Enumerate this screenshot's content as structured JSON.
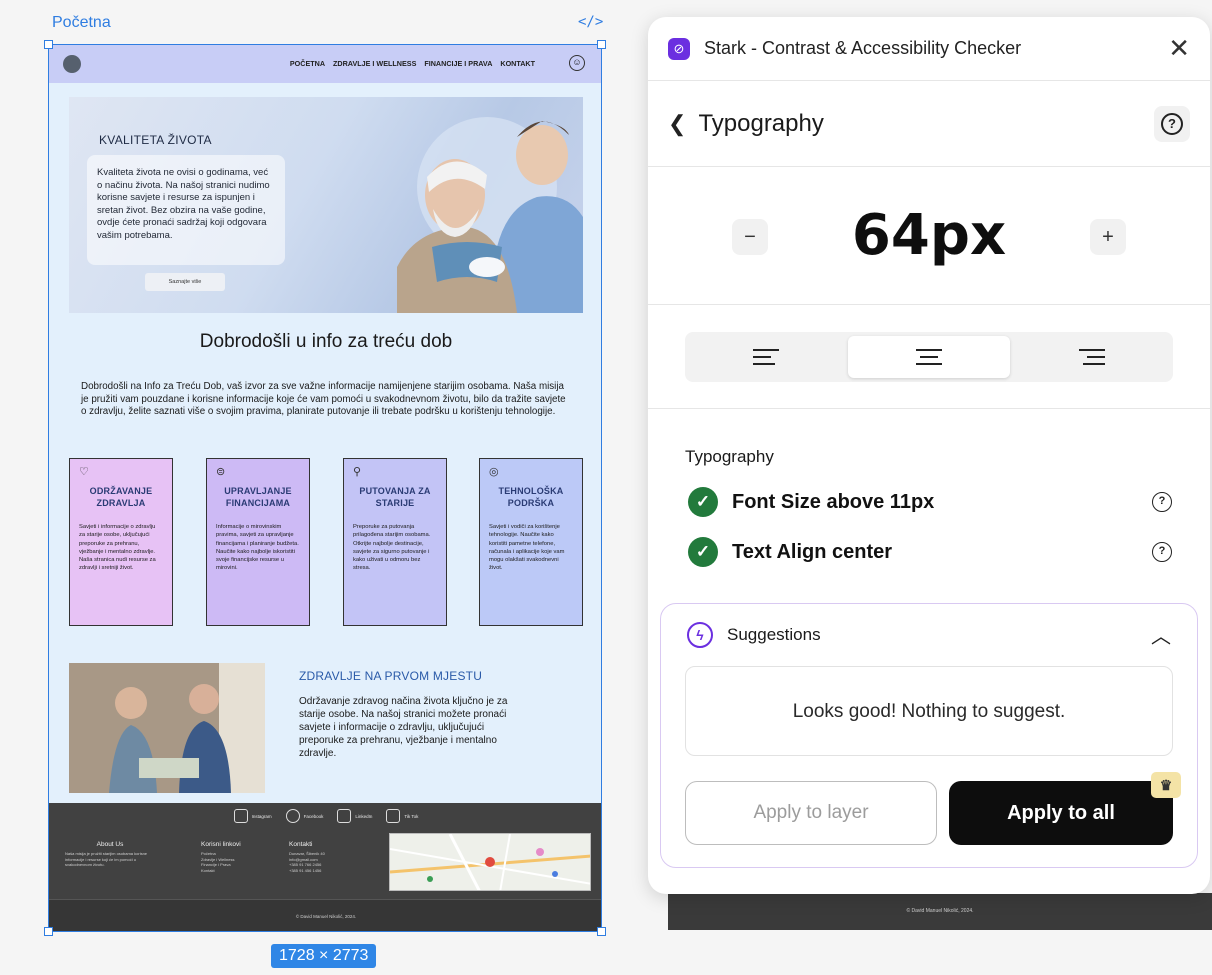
{
  "canvas": {
    "frame_label": "Početna",
    "code_icon": "</>",
    "size_badge": "1728 × 2773",
    "selection_color": "#2f7de1"
  },
  "site": {
    "nav": [
      "POČETNA",
      "ZDRAVLJE I WELLNESS",
      "FINANCIJE I PRAVA",
      "KONTAKT"
    ],
    "hero": {
      "title": "KVALITETA ŽIVOTA",
      "text": "Kvaliteta života ne ovisi o godinama, već o načinu života. Na našoj stranici nudimo korisne savjete i resurse za ispunjen i sretan život. Bez obzira na vaše godine, ovdje ćete pronaći sadržaj koji odgovara vašim potrebama.",
      "button": "Saznajte više"
    },
    "welcome_title": "Dobrodošli u info za treću dob",
    "intro": "Dobrodošli na Info za Treću Dob, vaš izvor za sve važne informacije namijenjene starijim osobama. Naša misija je pružiti vam pouzdane i korisne informacije koje će vam pomoći u svakodnevnom životu, bilo da tražite savjete o zdravlju, želite saznati više o svojim pravima, planirate putovanje ili trebate podršku u korištenju tehnologije.",
    "cards": [
      {
        "title": "ODRŽAVANJE ZDRAVLJA",
        "text": "Savjeti i informacije o zdravlju za starije osobe, uključujući preporuke za prehranu, vježbanje i mentalno zdravlje. Naša stranica nudi resurse za zdravlji i sretniji život.",
        "icon": "heart-pulse-icon",
        "color": "#e7c2f5"
      },
      {
        "title": "UPRAVLJANJE FINANCIJAMA",
        "text": "Informacije o mirovinskim pravima, savjeti za upravljanje financijama i planiranje budžeta. Naučite kako najbolje iskoristiti svoje financijske resurse u mirovini.",
        "icon": "coins-icon",
        "color": "#cdbaf5"
      },
      {
        "title": "PUTOVANJA ZA STARIJE",
        "text": "Preporuke za putovanja prilagođena starijim osobama. Otkrijte najbolje destinacije, savjete za sigurno putovanje i kako uživati u odmoru bez stresa.",
        "icon": "walker-icon",
        "color": "#c3c4f6"
      },
      {
        "title": "TEHNOLOŠKA PODRŠKA",
        "text": "Savjeti i vodiči za korištenje tehnologije. Naučite kako koristiti pametne telefone, računala i aplikacije koje vam mogu olakšati svakodnevni život.",
        "icon": "support-icon",
        "color": "#bcc9f7"
      }
    ],
    "section2": {
      "title": "ZDRAVLJE NA PRVOM MJESTU",
      "text": "Održavanje zdravog načina života ključno je za starije osobe. Na našoj stranici možete pronaći savjete i informacije o zdravlju, uključujući preporuke za prehranu, vježbanje i mentalno zdravlje."
    },
    "footer": {
      "social": [
        "Instagram",
        "Facebook",
        "LinkedIn",
        "Tik Tok"
      ],
      "about_title": "About Us",
      "about_text": "Naša misija je pružiti starijim osobama korisne informacije i resurse koji će im pomoći u svakodnevnom životu.",
      "links_title": "Korisni linkovi",
      "links": [
        "Početna",
        "Zdravlje i Wellness",
        "Financije i Prava",
        "Kontakt"
      ],
      "contact_title": "Kontakti",
      "contacts": [
        "Dunavar, Šibenik 40",
        "info@gmail.com",
        "+385 91 766 2456",
        "+385 91 456 1456"
      ],
      "copyright": "© David Manuel Nikolić, 2024."
    }
  },
  "panel": {
    "title": "Stark - Contrast & Accessibility Checker",
    "subtitle": "Typography",
    "font_size": "64px",
    "decrease": "−",
    "increase": "+",
    "alignments": [
      "left",
      "center",
      "right"
    ],
    "selected_alignment": "center",
    "section_title": "Typography",
    "checks": [
      {
        "label": "Font Size above 11px",
        "status": "pass"
      },
      {
        "label": "Text Align center",
        "status": "pass"
      }
    ],
    "suggestions": {
      "title": "Suggestions",
      "message": "Looks good! Nothing to suggest.",
      "apply_layer": "Apply to layer",
      "apply_all": "Apply to all"
    },
    "behind_copyright": "© David Manuel Nikolić, 2024.",
    "accent_color": "#6b2fe0",
    "pass_color": "#227a3c"
  }
}
